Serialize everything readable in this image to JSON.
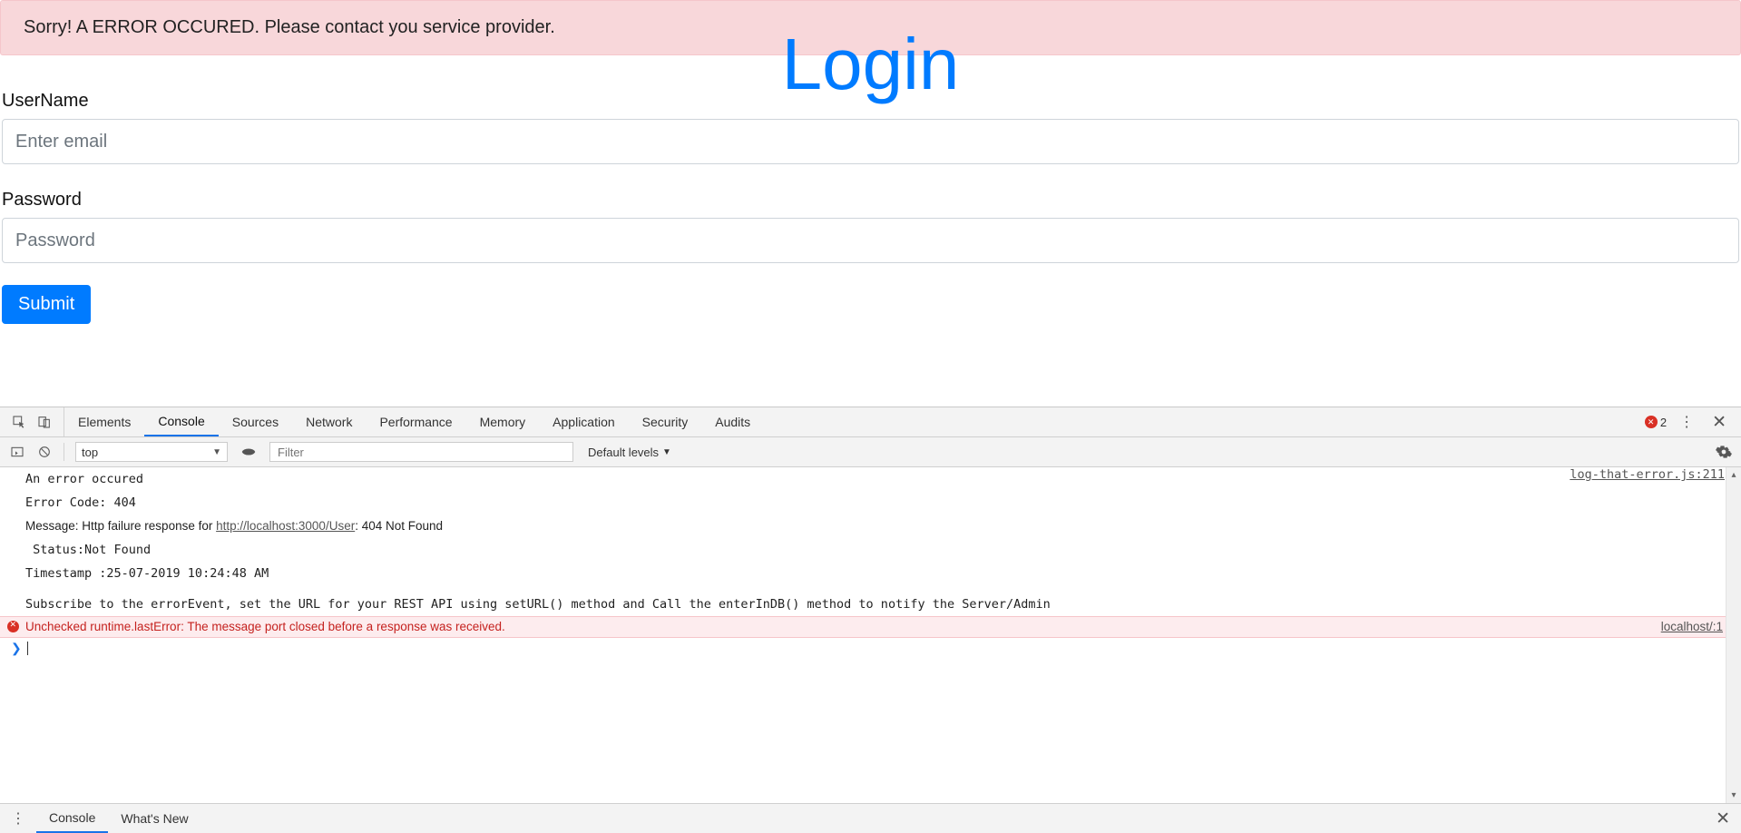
{
  "alert": {
    "message": "Sorry! A ERROR OCCURED. Please contact you service provider."
  },
  "login": {
    "title": "Login",
    "username_label": "UserName",
    "username_placeholder": "Enter email",
    "password_label": "Password",
    "password_placeholder": "Password",
    "submit_label": "Submit"
  },
  "devtools": {
    "tabs": {
      "elements": "Elements",
      "console": "Console",
      "sources": "Sources",
      "network": "Network",
      "performance": "Performance",
      "memory": "Memory",
      "application": "Application",
      "security": "Security",
      "audits": "Audits"
    },
    "error_count": "2",
    "filterbar": {
      "context": "top",
      "filter_placeholder": "Filter",
      "levels_label": "Default levels"
    },
    "console": {
      "block1_source": "log-that-error.js:211",
      "block1_line1": "An error occured",
      "block1_line2": "Error Code: 404",
      "block1_line3_pre": "Message: Http failure response for ",
      "block1_line3_link": "http://localhost:3000/User",
      "block1_line3_post": ": 404 Not Found",
      "block1_line4": " Status:Not Found",
      "block1_line5": "Timestamp :25-07-2019 10:24:48 AM",
      "block1_line6": "",
      "block1_line7": "Subscribe to the errorEvent, set the URL for your REST API using setURL() method and Call the enterInDB() method to notify the Server/Admin",
      "error_source": "localhost/:1",
      "error_text": "Unchecked runtime.lastError: The message port closed before a response was received."
    },
    "drawer": {
      "console": "Console",
      "whatsnew": "What's New"
    }
  }
}
